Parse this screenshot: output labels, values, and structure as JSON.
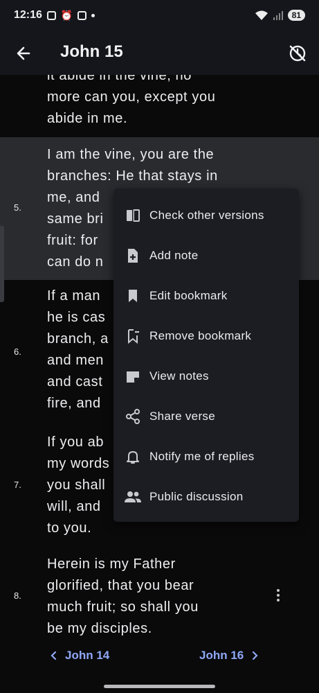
{
  "status_bar": {
    "time": "12:16",
    "battery": "81"
  },
  "app_bar": {
    "title": "John 15"
  },
  "verses": [
    {
      "number": "",
      "text": "it abide in the vine; no\nmore can you, except you\nabide in me."
    },
    {
      "number": "5.",
      "text": "I am the vine, you are the\nbranches: He that stays in\nme, and\nsame bri\nfruit: for\ncan do n"
    },
    {
      "number": "6.",
      "text": "If a man\nhe is cas\nbranch, a\nand men\nand cast\nfire, and"
    },
    {
      "number": "7.",
      "text": "If you ab\nmy words\nyou shall\nwill, and\nto you."
    },
    {
      "number": "8.",
      "text": "Herein is my Father\nglorified, that you bear\nmuch fruit; so shall you\nbe my disciples."
    }
  ],
  "context_menu": {
    "items": [
      {
        "label": "Check other versions",
        "icon": "compare-icon"
      },
      {
        "label": "Add note",
        "icon": "note-add-icon"
      },
      {
        "label": "Edit bookmark",
        "icon": "bookmark-icon"
      },
      {
        "label": "Remove bookmark",
        "icon": "bookmark-remove-icon"
      },
      {
        "label": "View notes",
        "icon": "notes-icon"
      },
      {
        "label": "Share verse",
        "icon": "share-icon"
      },
      {
        "label": "Notify me of replies",
        "icon": "bell-icon"
      },
      {
        "label": "Public discussion",
        "icon": "people-icon"
      }
    ]
  },
  "bottom_nav": {
    "prev": "John 14",
    "next": "John 16"
  },
  "colors": {
    "accent": "#8fa8f5",
    "selected_verse_bg": "#2a2b2f",
    "menu_bg": "#1c1d22"
  }
}
